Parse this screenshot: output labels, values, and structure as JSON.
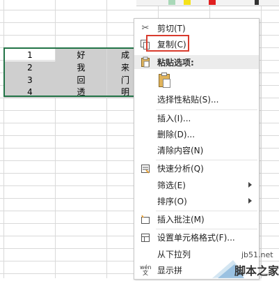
{
  "spreadsheet": {
    "rows": [
      [
        "1",
        "好",
        "成"
      ],
      [
        "2",
        "我",
        "来"
      ],
      [
        "3",
        "回",
        "门"
      ],
      [
        "4",
        "透",
        "明"
      ]
    ]
  },
  "menu": {
    "cut": "剪切(T)",
    "copy": "复制(C)",
    "paste_options": "粘贴选项:",
    "paste_special": "选择性粘贴(S)...",
    "insert": "插入(I)...",
    "delete": "删除(D)...",
    "clear": "清除内容(N)",
    "quick_analysis": "快速分析(Q)",
    "filter": "筛选(E)",
    "sort": "排序(O)",
    "insert_comment": "插入批注(M)",
    "format_cells": "设置单元格格式(F)...",
    "dropdown_pick": "从下拉列",
    "show_pinyin": "显示拼"
  },
  "watermark": {
    "domain": "jb51.net",
    "site_name": "脚本之家"
  },
  "colors": {
    "selection_border": "#217346",
    "highlight_box": "#d83b2d",
    "selected_cell_fill": "#cfcfcf"
  }
}
